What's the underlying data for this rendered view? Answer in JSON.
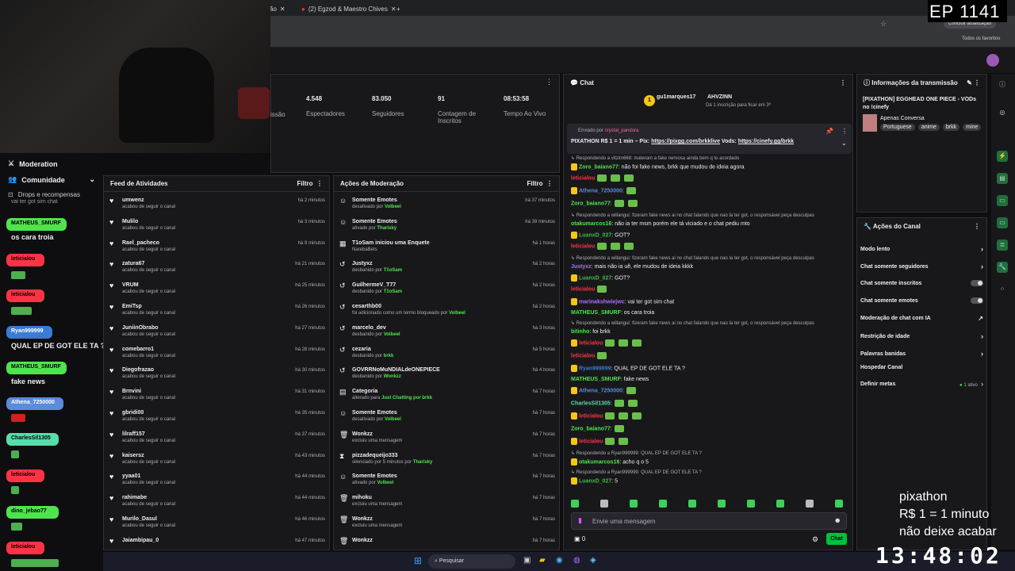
{
  "browser": {
    "tabs": [
      {
        "label": "ão"
      },
      {
        "label": "(2) Egzod & Maestro Chives"
      }
    ],
    "update_button": "Concluir atualização",
    "bookmarks": "Todos os favoritos"
  },
  "overlay": {
    "episode": "EP 1141",
    "pix1": "pixathon",
    "pix2": "R$ 1 = 1 minuto",
    "pix3": "não deixe acabar",
    "clock": "13:48:02"
  },
  "left_nav": {
    "moderation": "Moderation",
    "community": "Comunidade",
    "drops": "Drops e recompensas",
    "faded_user": "marinakshwiejw",
    "faded_msg": "vai ter got sim chat"
  },
  "overlay_chat": [
    {
      "user": "MATHEUS_SMURF",
      "text": "os cara troia",
      "color": "#4ee44e"
    },
    {
      "user": "leticialou",
      "text": "",
      "color": "#ff3344"
    },
    {
      "user": "leticialou",
      "text": "",
      "color": "#ff3344"
    },
    {
      "user": "Ryan999999",
      "text": "QUAL EP DE GOT ELE TA ?",
      "color": "#3a7bd5"
    },
    {
      "user": "MATHEUS_SMURF",
      "text": "fake news",
      "color": "#4ee44e"
    },
    {
      "user": "Athena_7250000",
      "text": "",
      "color": "#5b8bd9"
    },
    {
      "user": "CharlesSil1305",
      "text": "",
      "color": "#55ddaa"
    },
    {
      "user": "leticialou",
      "text": "",
      "color": "#ff3344"
    },
    {
      "user": "dino_jebao77",
      "text": "",
      "color": "#4ee44e"
    },
    {
      "user": "leticialou",
      "text": "",
      "color": "#ff3344"
    }
  ],
  "stats": {
    "partial": "issão",
    "viewers": {
      "value": "4.548",
      "label": "Espectadores"
    },
    "followers": {
      "value": "83.050",
      "label": "Seguidores"
    },
    "subs": {
      "value": "91",
      "label": "Contagem de Inscritos"
    },
    "uptime": {
      "value": "08:53:58",
      "label": "Tempo Ao Vivo"
    }
  },
  "activity": {
    "title": "Feed de Atividades",
    "filter": "Filtro",
    "items": [
      {
        "name": "umwenz",
        "sub": "acabou de seguir o canal",
        "time": "há 2 minutos"
      },
      {
        "name": "Mulilo",
        "sub": "acabou de seguir o canal",
        "time": "há 3 minutos"
      },
      {
        "name": "Rael_pacheco",
        "sub": "acabou de seguir o canal",
        "time": "há 9 minutos"
      },
      {
        "name": "zatura67",
        "sub": "acabou de seguir o canal",
        "time": "há 21 minutos"
      },
      {
        "name": "VRUM",
        "sub": "acabou de seguir o canal",
        "time": "há 25 minutos"
      },
      {
        "name": "EmiTsp",
        "sub": "acabou de seguir o canal",
        "time": "há 26 minutos"
      },
      {
        "name": "JuniinObrabo",
        "sub": "acabou de seguir o canal",
        "time": "há 27 minutos"
      },
      {
        "name": "comebarro1",
        "sub": "acabou de seguir o canal",
        "time": "há 28 minutos"
      },
      {
        "name": "Diegofrazao",
        "sub": "acabou de seguir o canal",
        "time": "há 30 minutos"
      },
      {
        "name": "Brnvini",
        "sub": "acabou de seguir o canal",
        "time": "há 31 minutos"
      },
      {
        "name": "gbridi00",
        "sub": "acabou de seguir o canal",
        "time": "há 35 minutos"
      },
      {
        "name": "lilraff157",
        "sub": "acabou de seguir o canal",
        "time": "há 37 minutos"
      },
      {
        "name": "kaisersz",
        "sub": "acabou de seguir o canal",
        "time": "há 43 minutos"
      },
      {
        "name": "yyaa01",
        "sub": "acabou de seguir o canal",
        "time": "há 44 minutos"
      },
      {
        "name": "rahimabe",
        "sub": "acabou de seguir o canal",
        "time": "há 44 minutos"
      },
      {
        "name": "Murilo_Dasul",
        "sub": "acabou de seguir o canal",
        "time": "há 46 minutos"
      },
      {
        "name": "Jaiambipau_0",
        "sub": "",
        "time": "há 47 minutos"
      }
    ]
  },
  "modactions": {
    "title": "Ações de Moderação",
    "filter": "Filtro",
    "items": [
      {
        "name": "Somente Emotes",
        "sub": "desativado por ",
        "by": "Volbeel",
        "time": "há 37 minutos"
      },
      {
        "name": "Somente Emotes",
        "sub": "ativado por ",
        "by": "Tharisky",
        "time": "há 39 minutos"
      },
      {
        "name": "T1oSam iniciou uma Enquete",
        "sub": "NarebaBets",
        "by": "",
        "time": "há 1 horas"
      },
      {
        "name": "Justyxz",
        "sub": "desbanido por ",
        "by": "T1oSam",
        "time": "há 2 horas"
      },
      {
        "name": "GuilhermeV_T77",
        "sub": "desbanido por ",
        "by": "T1oSam",
        "time": "há 2 horas"
      },
      {
        "name": "cesarthb00",
        "sub": "foi adicionado como um termo bloqueado por ",
        "by": "Volbeel",
        "time": "há 2 horas"
      },
      {
        "name": "marcelo_dev",
        "sub": "desbanido por ",
        "by": "Volbeel",
        "time": "há 3 horas"
      },
      {
        "name": "cezaria",
        "sub": "desbanido por ",
        "by": "brkk",
        "time": "há 5 horas"
      },
      {
        "name": "GOVRRNoMuNDIALdeONEPIECE",
        "sub": "desbanido por ",
        "by": "Wonkzz",
        "time": "há 4 horas"
      },
      {
        "name": "Categoria",
        "sub": "alterado para ",
        "by": "Just Chatting por brkk",
        "time": "há 7 horas"
      },
      {
        "name": "Somente Emotes",
        "sub": "desativado por ",
        "by": "Volbeel",
        "time": "há 7 horas"
      },
      {
        "name": "Wonkzz",
        "sub": "excluiu uma mensagem",
        "by": "",
        "time": "há 7 horas"
      },
      {
        "name": "pizzadequeijo333",
        "sub": "silenciado por 5 minutos por ",
        "by": "Tharisky",
        "time": "há 7 horas"
      },
      {
        "name": "Somente Emotes",
        "sub": "ativado por ",
        "by": "Volbeel",
        "time": "há 7 horas"
      },
      {
        "name": "mihoku",
        "sub": "excluiu uma mensagem",
        "by": "",
        "time": "há 7 horas"
      },
      {
        "name": "Wonkzz",
        "sub": "excluiu uma mensagem",
        "by": "",
        "time": "há 7 horas"
      },
      {
        "name": "Wonkzz",
        "sub": "",
        "by": "",
        "time": "há 7 horas"
      }
    ]
  },
  "chat": {
    "title": "Chat",
    "top_user": "gu1marques17",
    "top_count": "1",
    "top2": "AHVZINN",
    "top2_sub": "Dá 1 inscrição para ficar em 3º",
    "pinned_by": "Enviado por",
    "pinned_user": "crystal_pandora",
    "pinned_text": "PIXATHON R$ 1 = 1 min – Pix: ",
    "pinned_link1": "https://pixgg.com/brkklive",
    "pinned_mid": " Vods: ",
    "pinned_link2": "https://cinefy.gg/brkk",
    "lines": [
      {
        "reply": "",
        "user": "",
        "text": "Respondendo a vitzim668: materam a fake nervosa ainda bem q to acordado",
        "color": "#adadb8",
        "isreply": true
      },
      {
        "user": "Zoro_baiano77",
        "text": ": não foi fake news, brkk que mudou de ideia agora",
        "color": "#4ee44e"
      },
      {
        "user": "leticialou",
        "text": "",
        "color": "#ff3344"
      },
      {
        "user": "Athena_7250000",
        "text": ":",
        "color": "#5b8bd9"
      },
      {
        "user": "Zoro_baiano77",
        "text": ":",
        "color": "#4ee44e"
      },
      {
        "user": "",
        "text": "Respondendo a willangui: fizeram fake news ai no chat falando que nao la ter got, o responsável peça desculpas",
        "color": "#adadb8",
        "isreply": true
      },
      {
        "user": "otakumarcos16",
        "text": ": não ia ter msm porém ele tá viciado e o chat pediu mto",
        "color": "#4ee44e"
      },
      {
        "user": "LuanxD_027",
        "text": ": GOT?",
        "color": "#44bb44"
      },
      {
        "user": "leticialou",
        "text": "",
        "color": "#ff3344"
      },
      {
        "user": "",
        "text": "Respondendo a willangui: fizeram fake news ai no chat falando que nao la ter got, o responsável peça desculpas",
        "color": "#adadb8",
        "isreply": true
      },
      {
        "user": "Justyxz",
        "text": ": mais não ia uê, ele mudou de ideia kkkk",
        "color": "#a970ff"
      },
      {
        "user": "LuanxD_027",
        "text": ": GOT?",
        "color": "#44bb44"
      },
      {
        "user": "leticialou",
        "text": "",
        "color": "#ff3344"
      },
      {
        "user": "marinakshwiejwc",
        "text": ": vai ter got sim chat",
        "color": "#a970ff"
      },
      {
        "user": "MATHEUS_SMURF",
        "text": ": os cara troia",
        "color": "#4ee44e"
      },
      {
        "user": "",
        "text": "Respondendo a willangui: fizeram fake news ai no chat falando que nao la ter got, o responsável peça desculpas",
        "color": "#adadb8",
        "isreply": true
      },
      {
        "user": "bitinho",
        "text": ": foi brkk",
        "color": "#4ee44e"
      },
      {
        "user": "leticialou",
        "text": "",
        "color": "#ff3344"
      },
      {
        "user": "leticialou",
        "text": "",
        "color": "#ff3344"
      },
      {
        "user": "Ryan999999",
        "text": ": QUAL EP DE GOT ELE TA ?",
        "color": "#3a7bd5"
      },
      {
        "user": "MATHEUS_SMURF",
        "text": ": fake news",
        "color": "#4ee44e"
      },
      {
        "user": "Athena_7250000",
        "text": ":",
        "color": "#5b8bd9"
      },
      {
        "user": "CharlesSil1305",
        "text": ":",
        "color": "#55ddaa"
      },
      {
        "user": "leticialou",
        "text": "",
        "color": "#ff3344"
      },
      {
        "user": "Zoro_baiano77",
        "text": ":",
        "color": "#4ee44e"
      },
      {
        "user": "leticialou",
        "text": "",
        "color": "#ff3344"
      },
      {
        "user": "",
        "text": "Respondendo a Ryan999999: QUAL EP DE GOT ELE TA ?",
        "color": "#adadb8",
        "isreply": true
      },
      {
        "user": "otakumarcos16",
        "text": ": acho q o 5",
        "color": "#4ee44e"
      },
      {
        "user": "",
        "text": "Respondendo a Ryan999999: QUAL EP DE GOT ELE TA ?",
        "color": "#adadb8",
        "isreply": true
      },
      {
        "user": "LuanxD_027",
        "text": ": 5",
        "color": "#44bb44"
      }
    ],
    "input_placeholder": "Envie uma mensagem",
    "points": "0",
    "send": "Chat"
  },
  "info": {
    "title": "Informações da transmissão",
    "stream_title": "[PIXATHON] EGGHEAD ONE PIECE - VODs no !cinefy",
    "category": "Apenas Conversa",
    "tags": [
      "Portuguese",
      "anime",
      "brkk",
      "mine"
    ]
  },
  "actions": {
    "title": "Ações do Canal",
    "items": [
      {
        "label": "Modo lento",
        "kind": "chevron"
      },
      {
        "label": "Chat somente seguidores",
        "kind": "chevron"
      },
      {
        "label": "Chat somente inscritos",
        "kind": "toggle"
      },
      {
        "label": "Chat somente emotes",
        "kind": "toggle"
      },
      {
        "label": "Moderação de chat com IA",
        "kind": "link"
      },
      {
        "label": "Restrição de idade",
        "kind": "chevron"
      },
      {
        "label": "Palavras banidas",
        "kind": "chevron"
      },
      {
        "label": "Hospedar Canal",
        "kind": "none"
      },
      {
        "label": "Definir metas",
        "kind": "meta",
        "badge": "1 ativo"
      }
    ]
  },
  "taskbar": {
    "search": "Pesquisar"
  }
}
